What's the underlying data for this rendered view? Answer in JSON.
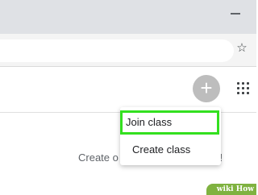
{
  "browser": {
    "minimize_label": "–",
    "star_icon": "star-outline-icon"
  },
  "appbar": {
    "plus_label": "+",
    "apps_icon": "apps-grid-icon"
  },
  "menu": {
    "items": [
      {
        "label": "Join class",
        "highlighted": true
      },
      {
        "label": "Create class",
        "highlighted": false
      }
    ],
    "highlight_color": "#33e01f"
  },
  "background": {
    "create_prefix": "Create o",
    "create_suffix": "s!"
  },
  "watermark": {
    "text": "wiki How"
  }
}
